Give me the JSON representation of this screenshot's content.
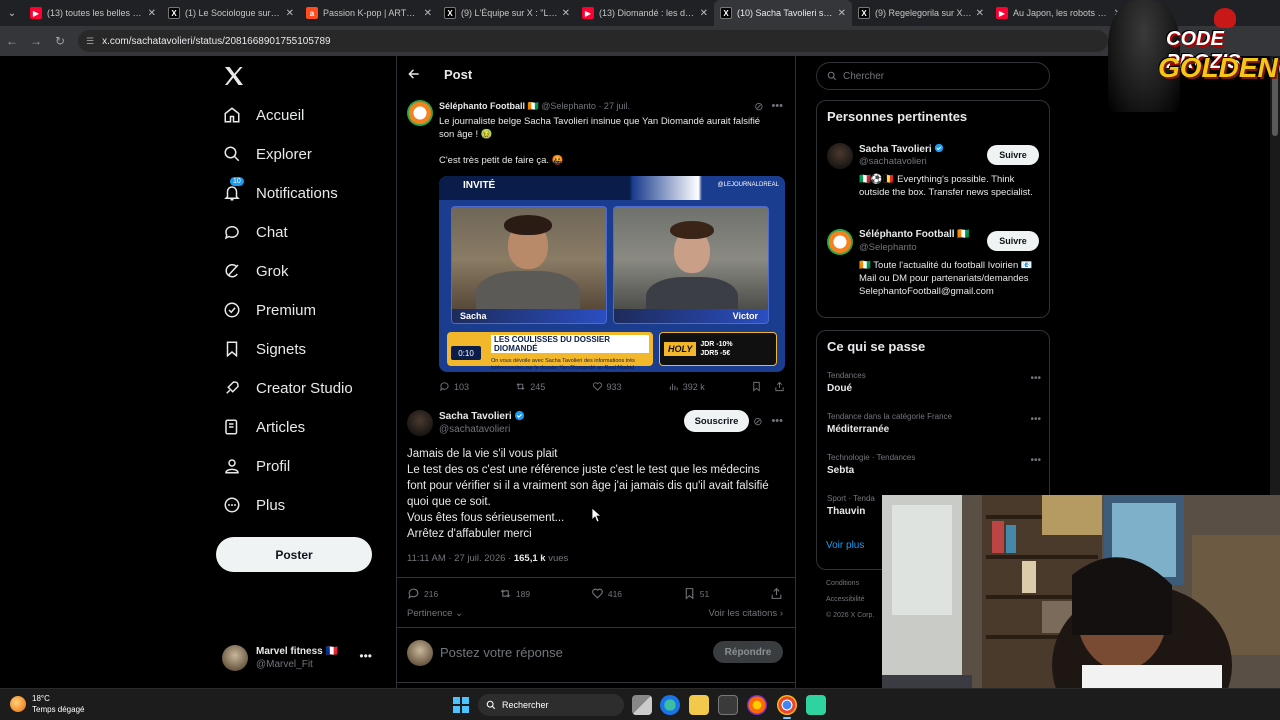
{
  "browser": {
    "tabs": [
      {
        "title": "(13) toutes les belles cho...",
        "favicon": "youtube"
      },
      {
        "title": "(1) Le Sociologue sur X : \"",
        "favicon": "x"
      },
      {
        "title": "Passion K-pop | ARTE Reg...",
        "favicon": "arte"
      },
      {
        "title": "(9) L'Équipe sur X : \"La dé...",
        "favicon": "x"
      },
      {
        "title": "(13) Diomandé : les desso...",
        "favicon": "youtube"
      },
      {
        "title": "(10) Sacha Tavolieri sur X",
        "favicon": "x",
        "active": true
      },
      {
        "title": "(9) Regelegorila sur X : \"Q...",
        "favicon": "x"
      },
      {
        "title": "Au Japon, les robots ont...",
        "favicon": "youtube"
      }
    ],
    "url": "x.com/sachatavolieri/status/2081668901755105789"
  },
  "nav": {
    "items": [
      {
        "label": "Accueil",
        "icon": "home-icon"
      },
      {
        "label": "Explorer",
        "icon": "search-icon"
      },
      {
        "label": "Notifications",
        "icon": "bell-icon",
        "badge": "10"
      },
      {
        "label": "Chat",
        "icon": "chat-icon"
      },
      {
        "label": "Grok",
        "icon": "grok-icon"
      },
      {
        "label": "Premium",
        "icon": "premium-icon"
      },
      {
        "label": "Signets",
        "icon": "bookmark-icon"
      },
      {
        "label": "Creator Studio",
        "icon": "rocket-icon"
      },
      {
        "label": "Articles",
        "icon": "article-icon"
      },
      {
        "label": "Profil",
        "icon": "person-icon"
      },
      {
        "label": "Plus",
        "icon": "more-circle-icon"
      }
    ],
    "post_button": "Poster",
    "account": {
      "name": "Marvel fitness 🇫🇷",
      "handle": "@Marvel_Fit"
    }
  },
  "header": {
    "title": "Post"
  },
  "quoted_post": {
    "author": "Séléphanto Football 🇨🇮",
    "handle": "@Selephanto",
    "date": "· 27 juil.",
    "text_line1": "Le journaliste belge Sacha Tavolieri insinue que Yan Diomandé aurait falsifié son âge ! 🤢",
    "text_line2": "C'est très petit de faire ça. 🤬",
    "video": {
      "badge": "INVITÉ",
      "channel": "@LEJOURNALDREAL",
      "left_name": "Sacha",
      "right_name": "Victor",
      "lower_title": "LES COULISSES DU DOSSIER DIOMANDÉ",
      "lower_sub": "On vous dévoile avec Sacha Tavolieri des informations très intéressantes sur le dossier Yan Diomandé au Real Madrid",
      "time": "0:10",
      "ad_brand": "HOLY",
      "ad_line1": "JDR -10%",
      "ad_line2": "JDR5 -5€"
    },
    "stats": {
      "replies": "103",
      "reposts": "245",
      "likes": "933",
      "views": "392 k"
    }
  },
  "main_post": {
    "author": "Sacha Tavolieri",
    "handle": "@sachatavolieri",
    "subscribe": "Souscrire",
    "lines": [
      "Jamais de la vie s'il vous plait",
      "Le test des os c'est une référence juste c'est le test que les médecins",
      "font pour vérifier si il a vraiment son âge j'ai jamais dis qu'il avait falsifié",
      "quoi que ce soit.",
      "Vous êtes fous sérieusement...",
      "Arrêtez d'affabuler merci"
    ],
    "timestamp": "11:11 AM · 27 juil. 2026 · ",
    "views": "165,1 k",
    "views_suffix": " vues",
    "stats": {
      "replies": "216",
      "reposts": "189",
      "likes": "416",
      "bookmarks": "51"
    },
    "sort_label": "Pertinence",
    "quotes_link": "Voir les citations"
  },
  "composer": {
    "placeholder": "Postez votre réponse",
    "button": "Répondre"
  },
  "right": {
    "search_placeholder": "Chercher",
    "relevant": {
      "title": "Personnes pertinentes",
      "users": [
        {
          "name": "Sacha Tavolieri",
          "handle": "@sachatavolieri",
          "bio": "🇮🇹⚽🇧🇪 Everything's possible. Think outside the box. Transfer news specialist.",
          "button": "Suivre"
        },
        {
          "name": "Séléphanto Football 🇨🇮",
          "handle": "@Selephanto",
          "bio": "🇨🇮 Toute l'actualité du football Ivoirien 📧 Mail ou DM pour partenariats/demandes SelephantoFootball@gmail.com",
          "button": "Suivre"
        }
      ]
    },
    "trends": {
      "title": "Ce qui se passe",
      "items": [
        {
          "category": "Tendances",
          "name": "Doué"
        },
        {
          "category": "Tendance dans la catégorie France",
          "name": "Méditerranée"
        },
        {
          "category": "Technologie · Tendances",
          "name": "Sebta"
        },
        {
          "category": "Sport · Tenda",
          "name": "Thauvin"
        }
      ],
      "more": "Voir plus"
    },
    "footer": [
      "Conditions",
      "Accessibilité",
      "© 2026 X Corp."
    ]
  },
  "overlay": {
    "line1": "CODE PROZIS",
    "line2": "GOLDENG"
  },
  "taskbar": {
    "temperature": "18°C",
    "weather": "Temps dégagé",
    "search": "Rechercher"
  },
  "colors": {
    "accent": "#1d9bf0",
    "background": "#000000",
    "verified": "#1d9bf0"
  }
}
